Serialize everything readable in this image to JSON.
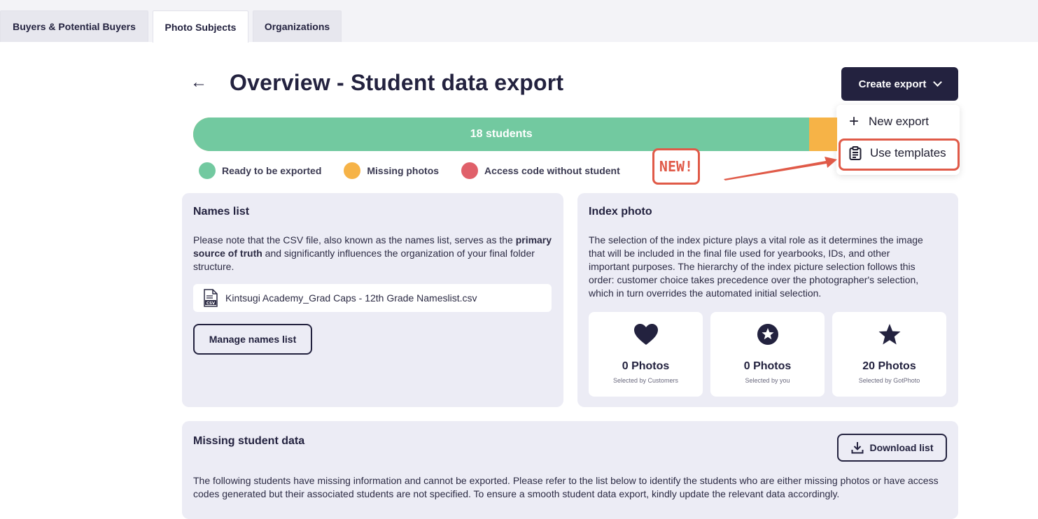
{
  "tabs": [
    {
      "label": "Buyers & Potential Buyers"
    },
    {
      "label": "Photo Subjects"
    },
    {
      "label": "Organizations"
    }
  ],
  "header": {
    "back_icon": "arrow-left-icon",
    "title": "Overview - Student data export",
    "create_export_label": "Create export"
  },
  "dropdown": {
    "new_export_label": "New export",
    "use_templates_label": "Use templates"
  },
  "progress": {
    "ready_label": "18 students",
    "ready_fraction": 0.957,
    "missing_fraction": 0.043
  },
  "legend": [
    {
      "label": "Ready to be exported",
      "color": "#72c9a0"
    },
    {
      "label": "Missing photos",
      "color": "#f6b347"
    },
    {
      "label": "Access code without student",
      "color": "#e0606a"
    }
  ],
  "annotation": {
    "badge_text": "NEW!",
    "color": "#e05a48"
  },
  "names_list": {
    "title": "Names list",
    "text_before": "Please note that the CSV file, also known as the names list, serves as the ",
    "text_bold": "primary source of truth",
    "text_after": " and significantly influences the organization of your final folder structure.",
    "file_icon": "csv-file-icon",
    "file_name": "Kintsugi Academy_Grad Caps - 12th Grade Nameslist.csv",
    "manage_button": "Manage names list"
  },
  "index_photo": {
    "title": "Index photo",
    "text": "The selection of the index picture plays a vital role as it determines the image that will be included in the final file used for yearbooks, IDs, and other important purposes. The hierarchy of the index picture selection follows this order: customer choice takes precedence over the photographer's selection, which in turn overrides the automated initial selection.",
    "stats": [
      {
        "icon": "heart-icon",
        "value": "0 Photos",
        "label": "Selected by Customers"
      },
      {
        "icon": "star-circle-icon",
        "value": "0 Photos",
        "label": "Selected by you"
      },
      {
        "icon": "star-icon",
        "value": "20 Photos",
        "label": "Selected by GotPhoto"
      }
    ]
  },
  "missing_data": {
    "title": "Missing student data",
    "download_button": "Download list",
    "text": "The following students have missing information and cannot be exported. Please refer to the list below to identify the students who are either missing photos or have access codes generated but their associated students are not specified. To ensure a smooth student data export, kindly update the relevant data accordingly."
  }
}
